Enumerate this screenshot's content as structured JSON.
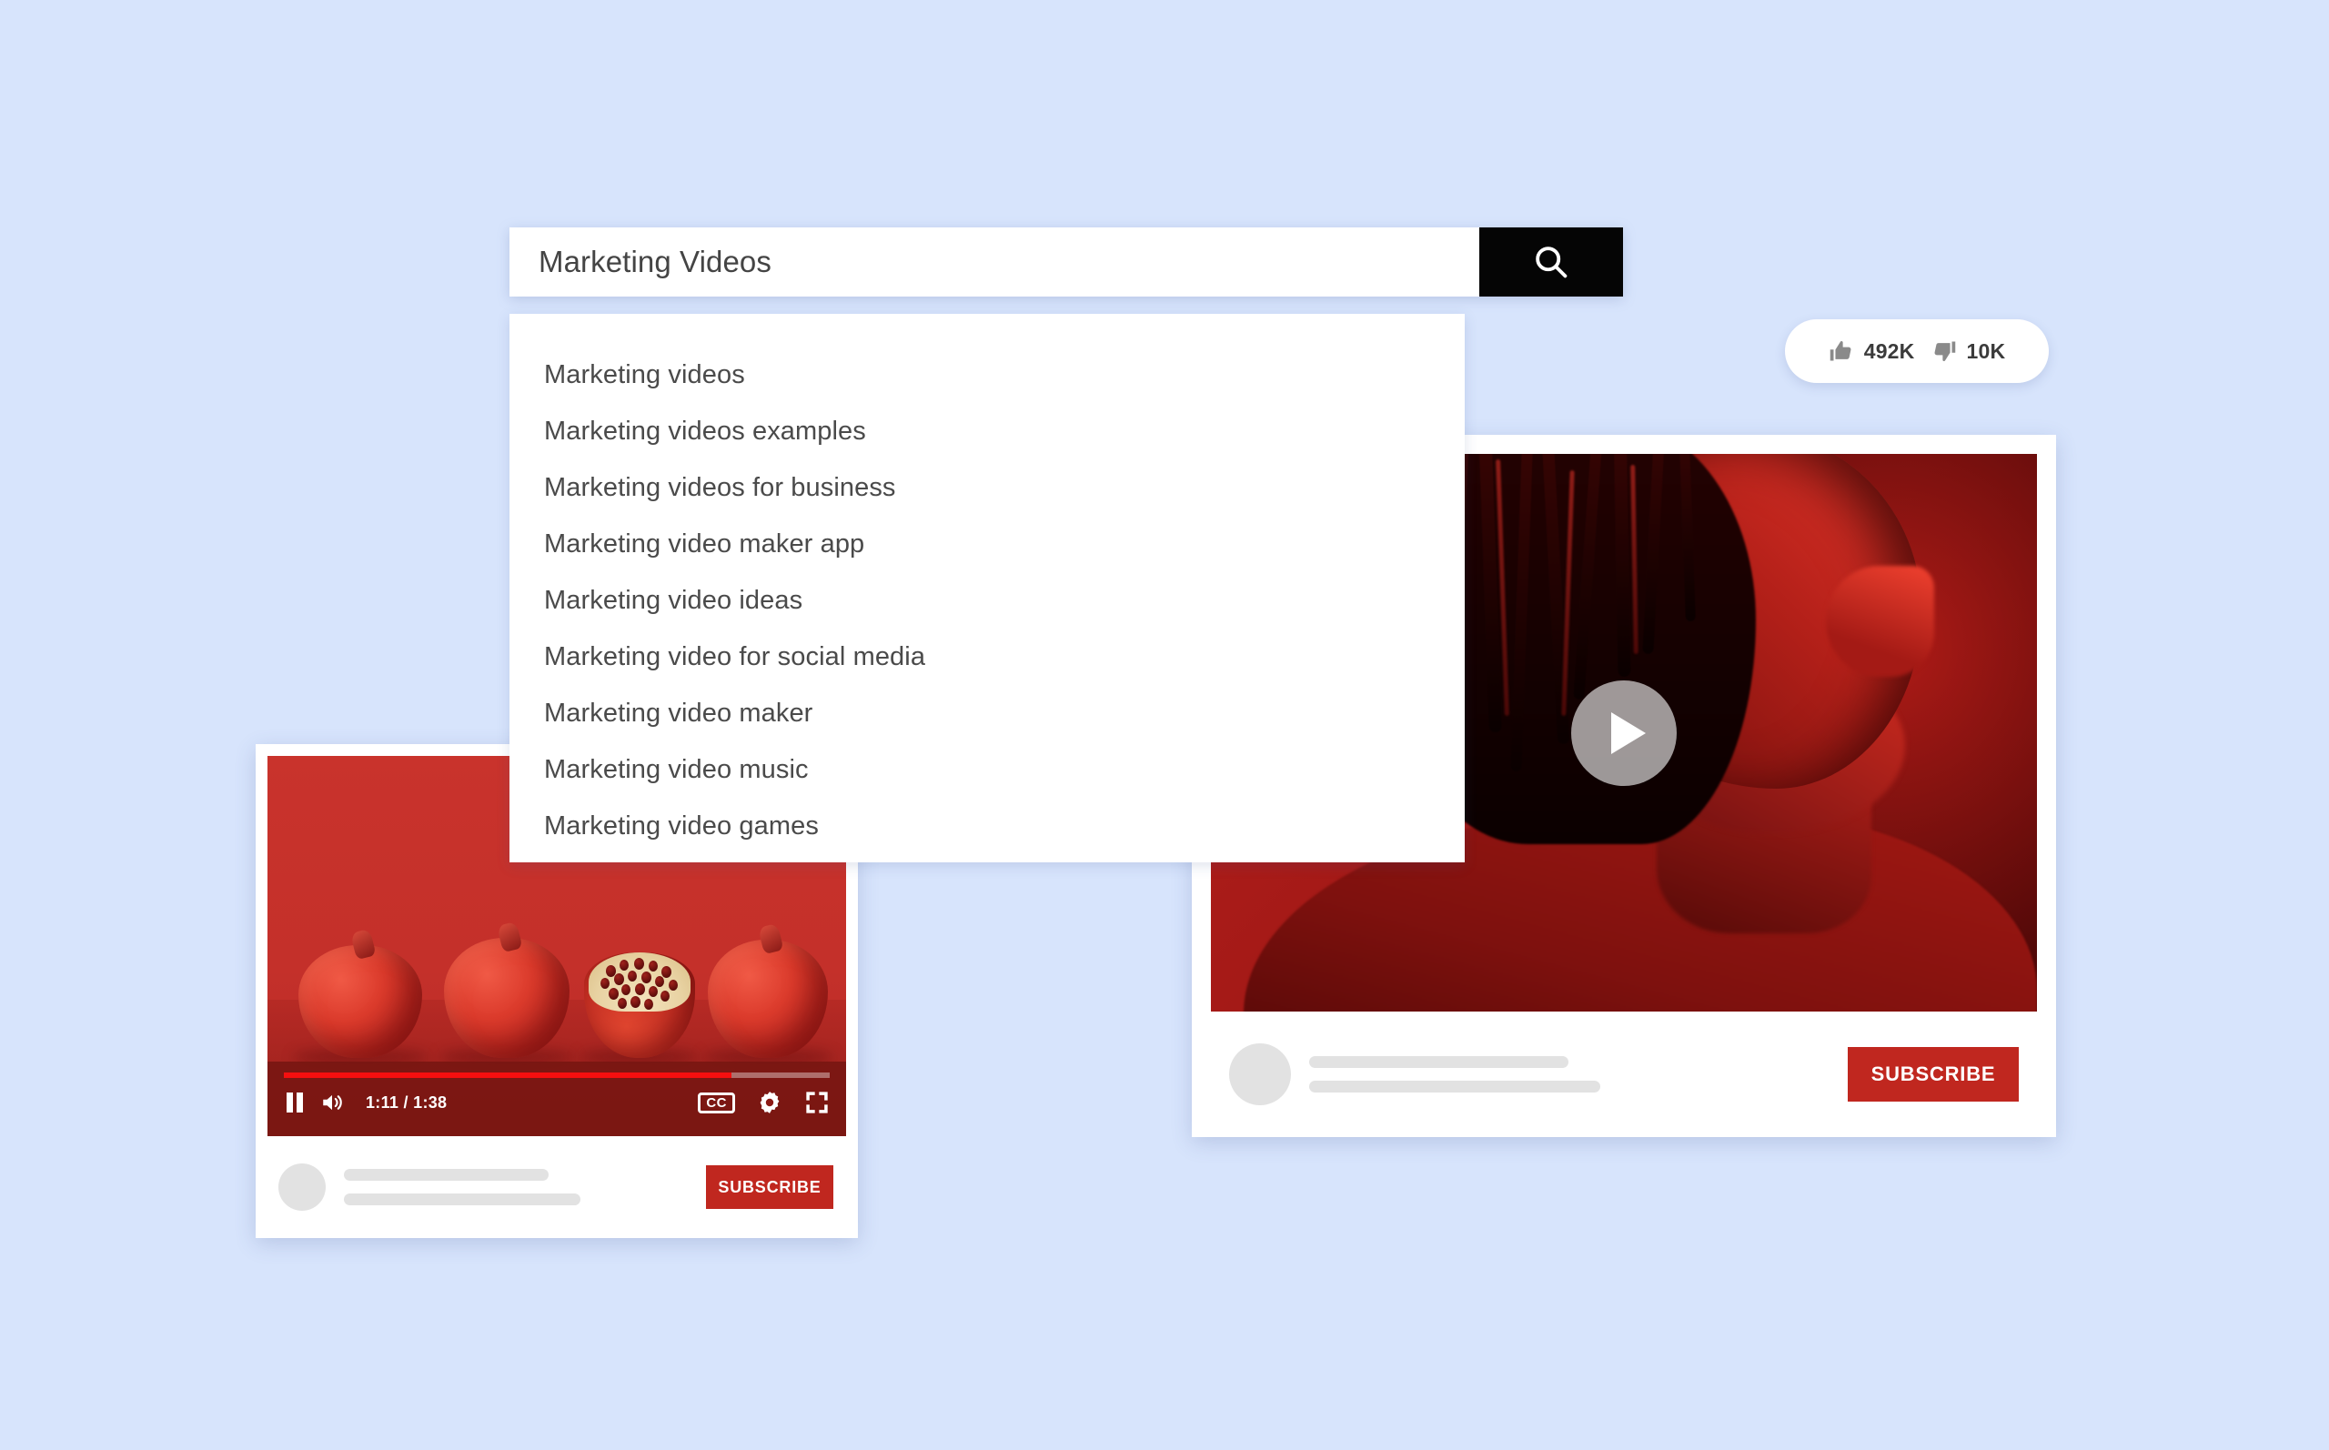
{
  "background_color": "#d7e4fc",
  "search": {
    "value": "Marketing Videos",
    "placeholder": "Search",
    "button_icon": "search-icon",
    "button_color": "#050505"
  },
  "suggestions": {
    "items": [
      "Marketing videos",
      "Marketing videos examples",
      "Marketing videos for business",
      "Marketing video maker app",
      "Marketing video ideas",
      "Marketing video for social media",
      "Marketing video maker",
      "Marketing video music",
      "Marketing video games"
    ]
  },
  "reactions": {
    "like_icon": "thumbs-up-icon",
    "like_count": "492K",
    "dislike_icon": "thumbs-down-icon",
    "dislike_count": "10K"
  },
  "video_card_left": {
    "thumbnail_alt": "Four pomegranates on a red background, one cut open showing seeds",
    "accent_color": "#c0271f",
    "controls": {
      "play_pause_icon": "pause-icon",
      "volume_icon": "volume-icon",
      "current_time": "1:11",
      "duration": "1:38",
      "time_display": "1:11 / 1:38",
      "progress_percent": 82,
      "captions_label": "CC",
      "settings_icon": "gear-icon",
      "fullscreen_icon": "fullscreen-icon"
    },
    "meta": {
      "avatar_icon": "avatar",
      "subscribe_label": "SUBSCRIBE"
    }
  },
  "video_card_right": {
    "thumbnail_alt": "Red duotone profile portrait of a person with dreadlocks",
    "accent_color": "#c0271f",
    "play_icon": "play-icon",
    "meta": {
      "avatar_icon": "avatar",
      "subscribe_label": "SUBSCRIBE"
    }
  }
}
